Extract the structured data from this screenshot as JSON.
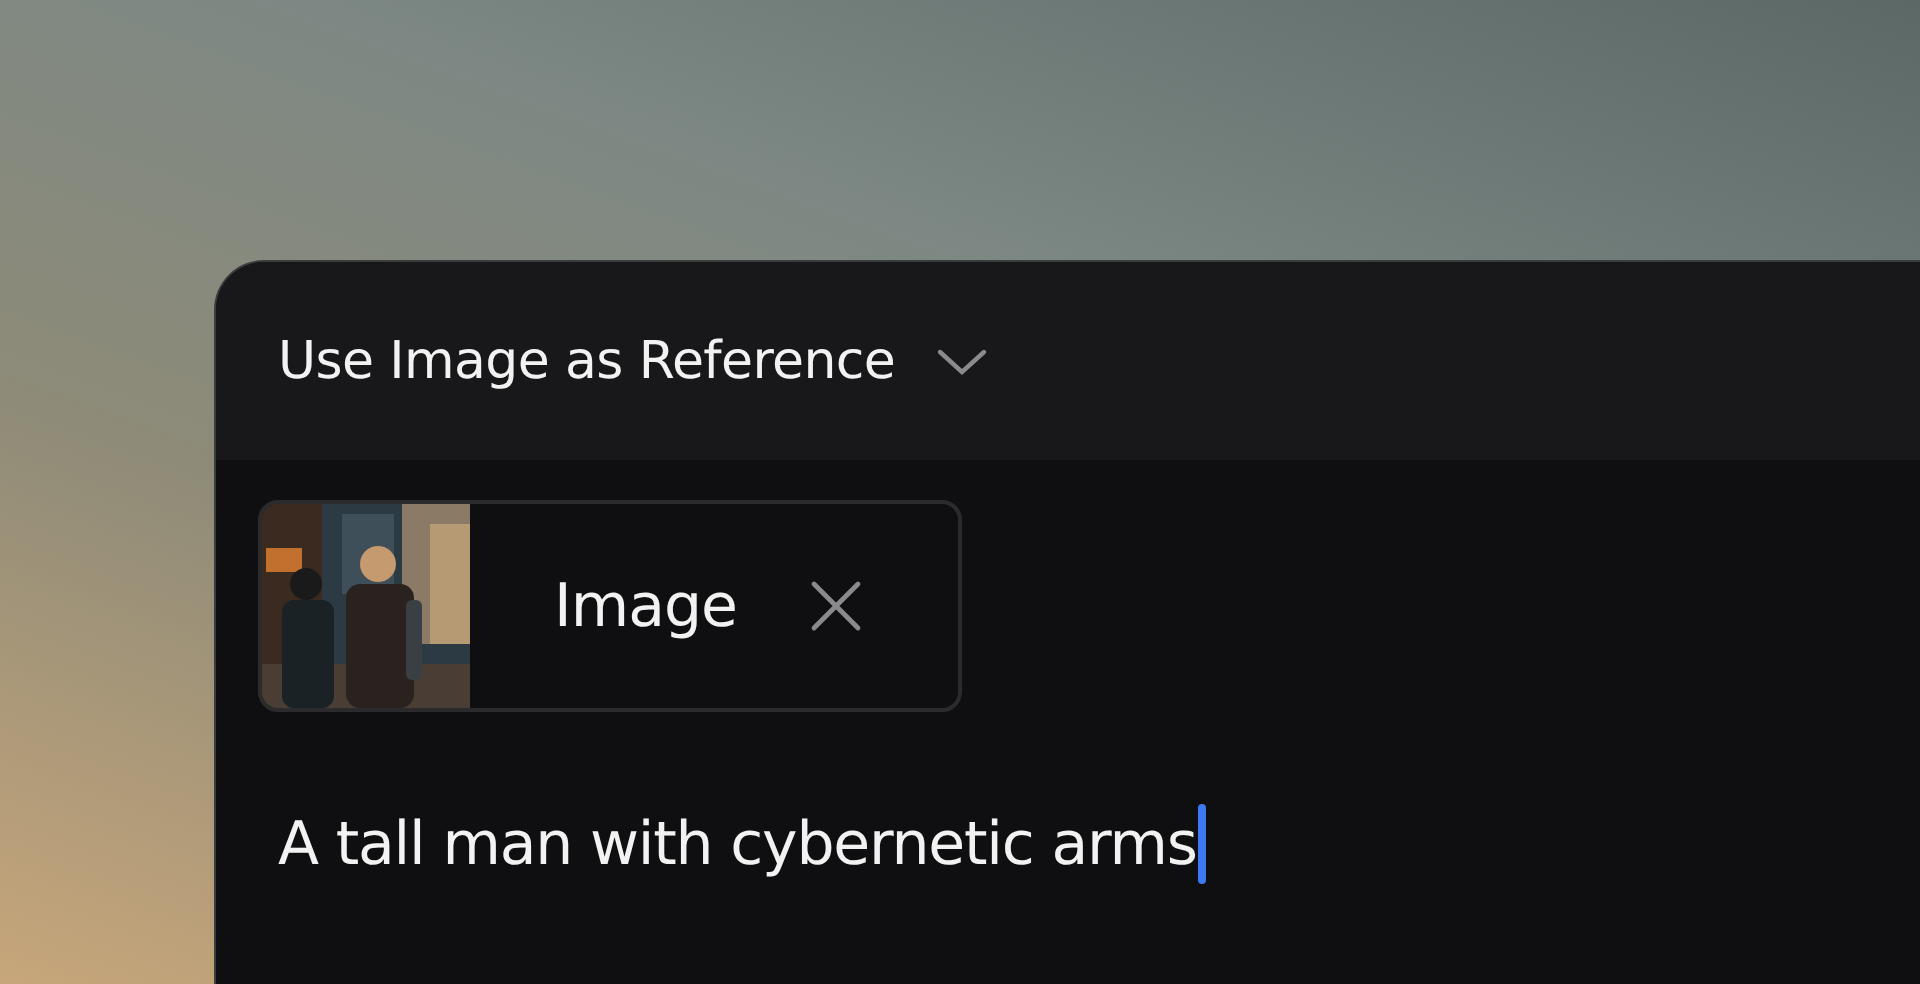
{
  "header": {
    "title": "Use Image as Reference"
  },
  "attachment": {
    "label": "Image"
  },
  "prompt": {
    "value": "A tall man with cybernetic arms"
  }
}
